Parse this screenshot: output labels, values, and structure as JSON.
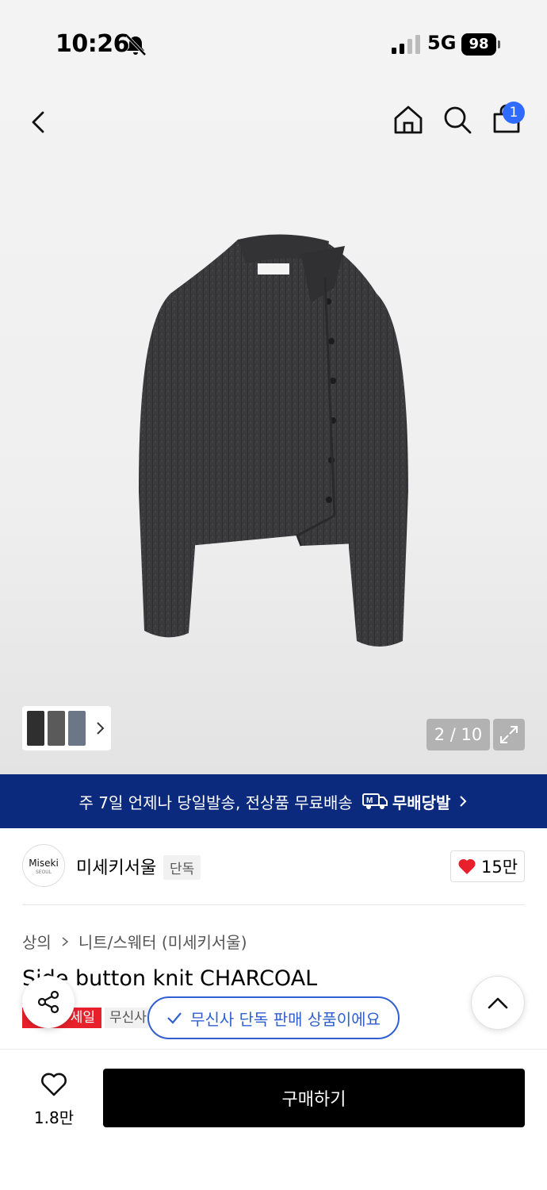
{
  "status_bar": {
    "time": "10:26",
    "network": "5G",
    "battery": "98"
  },
  "nav": {
    "cart_count": "1"
  },
  "gallery": {
    "counter": "2 / 10"
  },
  "banner": {
    "text": "주 7일 언제나 당일발송, 전상품 무료배송",
    "brand": "무배당발"
  },
  "brand": {
    "logo_text": "Miseki",
    "logo_sub": "SEOUL",
    "name": "미세키서울",
    "tag": "단독",
    "likes": "15만"
  },
  "breadcrumb": {
    "category": "상의",
    "subcategory": "니트/스웨터 (미세키서울)"
  },
  "product": {
    "title": "Side button knit CHARCOAL",
    "sale_tag": "세일",
    "exclusive_tag": "무신사"
  },
  "toast": {
    "text": "무신사 단독 판매 상품이에요"
  },
  "bottom": {
    "wish_count": "1.8만",
    "buy_label": "구매하기"
  },
  "colors": {
    "banner_bg": "#0b2a7d",
    "badge_blue": "#2f6bff",
    "sale_red": "#e8202c",
    "toast_blue": "#2f5fd1"
  }
}
